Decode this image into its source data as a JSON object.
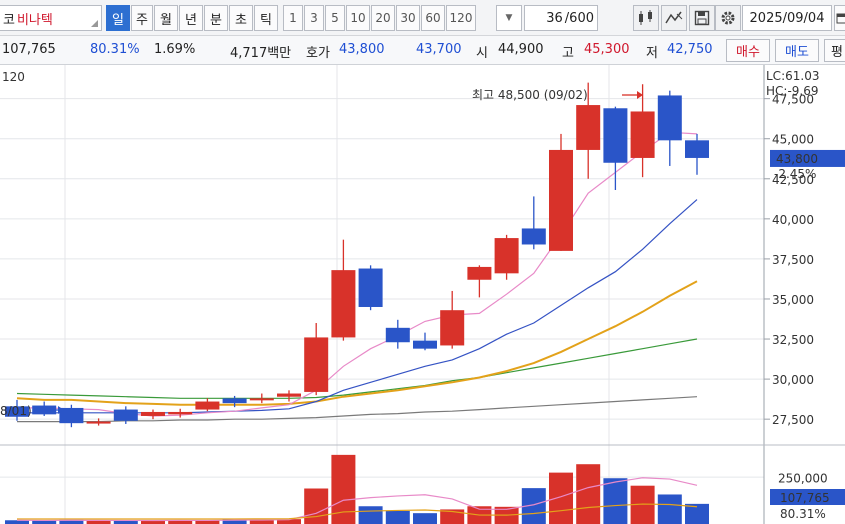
{
  "toolbar": {
    "stock_name_prefix": "코",
    "stock_name": "비나텍",
    "periods": [
      "일",
      "주",
      "월",
      "년",
      "분",
      "초",
      "틱"
    ],
    "active_period": "일",
    "intervals": [
      "1",
      "3",
      "5",
      "10",
      "20",
      "30",
      "60",
      "120"
    ],
    "count": "36",
    "count_total": "/600",
    "date": "2025/09/04"
  },
  "quote": {
    "volume": "107,765",
    "volume_ratio": "80.31%",
    "turnover": "1.69%",
    "amount": "4,717백만",
    "ask_label": "호가",
    "ask": "43,800",
    "bid": "43,700",
    "open_label": "시",
    "open": "44,900",
    "high_label": "고",
    "high": "45,300",
    "low_label": "저",
    "low": "42,750",
    "buy_label": "매수",
    "sell_label": "매도",
    "extra_label": "평"
  },
  "colors": {
    "up": "#d8322a",
    "down": "#2a55c8",
    "ma5": "#e88ac8",
    "ma10": "#3553c4",
    "ma20": "#e3a21a",
    "ma60": "#3a9a3a",
    "ma120": "#7a7a7a"
  },
  "chart_data": {
    "type": "candlestick",
    "ma_label": "120",
    "high_annotation": "최고 48,500 (09/02)",
    "low_annotation": "8/01)",
    "lc_label": "LC:61.03",
    "hc_label": "HC:-9.69",
    "current_price": "43,800",
    "change_pct": "-2.45%",
    "volume_current": "107,765",
    "volume_ratio": "80.31%",
    "volume_tick": "250,000",
    "y_ticks": [
      "47,500",
      "45,000",
      "42,500",
      "40,000",
      "37,500",
      "35,000",
      "32,500",
      "30,000",
      "27,500"
    ],
    "y_range": [
      26200,
      49600
    ],
    "volume_range": [
      0,
      380000
    ],
    "candles": [
      {
        "o": 28300,
        "h": 28700,
        "l": 27400,
        "c": 27650
      },
      {
        "o": 28350,
        "h": 28600,
        "l": 27700,
        "c": 27800
      },
      {
        "o": 28200,
        "h": 28400,
        "l": 27000,
        "c": 27250
      },
      {
        "o": 27300,
        "h": 27550,
        "l": 27100,
        "c": 27350
      },
      {
        "o": 28100,
        "h": 28300,
        "l": 27200,
        "c": 27400
      },
      {
        "o": 27700,
        "h": 28100,
        "l": 27500,
        "c": 27950
      },
      {
        "o": 27800,
        "h": 28150,
        "l": 27600,
        "c": 27950
      },
      {
        "o": 28100,
        "h": 28800,
        "l": 28000,
        "c": 28600
      },
      {
        "o": 28800,
        "h": 28950,
        "l": 28250,
        "c": 28500
      },
      {
        "o": 28700,
        "h": 29100,
        "l": 28500,
        "c": 28800
      },
      {
        "o": 28900,
        "h": 29300,
        "l": 28600,
        "c": 29100
      },
      {
        "o": 29200,
        "h": 33500,
        "l": 29000,
        "c": 32600
      },
      {
        "o": 32600,
        "h": 38700,
        "l": 32400,
        "c": 36800
      },
      {
        "o": 36900,
        "h": 37100,
        "l": 34300,
        "c": 34500
      },
      {
        "o": 33200,
        "h": 33700,
        "l": 31900,
        "c": 32300
      },
      {
        "o": 32400,
        "h": 32900,
        "l": 31800,
        "c": 31900
      },
      {
        "o": 32100,
        "h": 35500,
        "l": 31900,
        "c": 34300
      },
      {
        "o": 36200,
        "h": 37100,
        "l": 35100,
        "c": 37000
      },
      {
        "o": 36600,
        "h": 39000,
        "l": 36200,
        "c": 38800
      },
      {
        "o": 39400,
        "h": 41400,
        "l": 38100,
        "c": 38400
      },
      {
        "o": 38000,
        "h": 45300,
        "l": 38000,
        "c": 44300
      },
      {
        "o": 44300,
        "h": 48500,
        "l": 42500,
        "c": 47100
      },
      {
        "o": 46900,
        "h": 47000,
        "l": 41800,
        "c": 43500
      },
      {
        "o": 43800,
        "h": 48400,
        "l": 42600,
        "c": 46700
      },
      {
        "o": 47700,
        "h": 48000,
        "l": 43300,
        "c": 44900
      },
      {
        "o": 44900,
        "h": 45300,
        "l": 42750,
        "c": 43800
      }
    ],
    "volumes": [
      20000,
      18000,
      22000,
      17000,
      19000,
      18000,
      21000,
      20000,
      25000,
      24000,
      26000,
      190000,
      370000,
      95000,
      70000,
      58000,
      78000,
      95000,
      92000,
      192000,
      275000,
      320000,
      245000,
      205000,
      158000,
      107765
    ],
    "ma5": [
      28200,
      28200,
      28150,
      28100,
      27850,
      27700,
      27750,
      27900,
      28000,
      28200,
      28400,
      29300,
      30800,
      31900,
      32700,
      33600,
      34000,
      34100,
      35300,
      36600,
      39000,
      41600,
      42900,
      44200,
      45400,
      45300
    ],
    "ma10": [
      27900,
      27900,
      27900,
      27900,
      27900,
      27900,
      27900,
      27950,
      28000,
      28050,
      28150,
      28600,
      29300,
      29800,
      30300,
      30800,
      31200,
      31900,
      32800,
      33500,
      34600,
      35700,
      36700,
      38100,
      39700,
      41200
    ],
    "ma20": [
      28800,
      28700,
      28700,
      28600,
      28500,
      28450,
      28400,
      28400,
      28400,
      28400,
      28450,
      28600,
      28900,
      29100,
      29300,
      29550,
      29800,
      30100,
      30500,
      31000,
      31700,
      32500,
      33300,
      34200,
      35200,
      36100
    ],
    "ma60": [
      29100,
      29050,
      29000,
      28950,
      28900,
      28850,
      28800,
      28800,
      28800,
      28800,
      28800,
      28850,
      29000,
      29200,
      29400,
      29600,
      29900,
      30100,
      30400,
      30700,
      31000,
      31300,
      31600,
      31900,
      32200,
      32500
    ],
    "ma120": [
      27350,
      27350,
      27350,
      27350,
      27400,
      27400,
      27450,
      27450,
      27500,
      27500,
      27550,
      27600,
      27700,
      27800,
      27850,
      27950,
      28000,
      28100,
      28200,
      28300,
      28400,
      28500,
      28600,
      28700,
      28800,
      28900
    ]
  }
}
